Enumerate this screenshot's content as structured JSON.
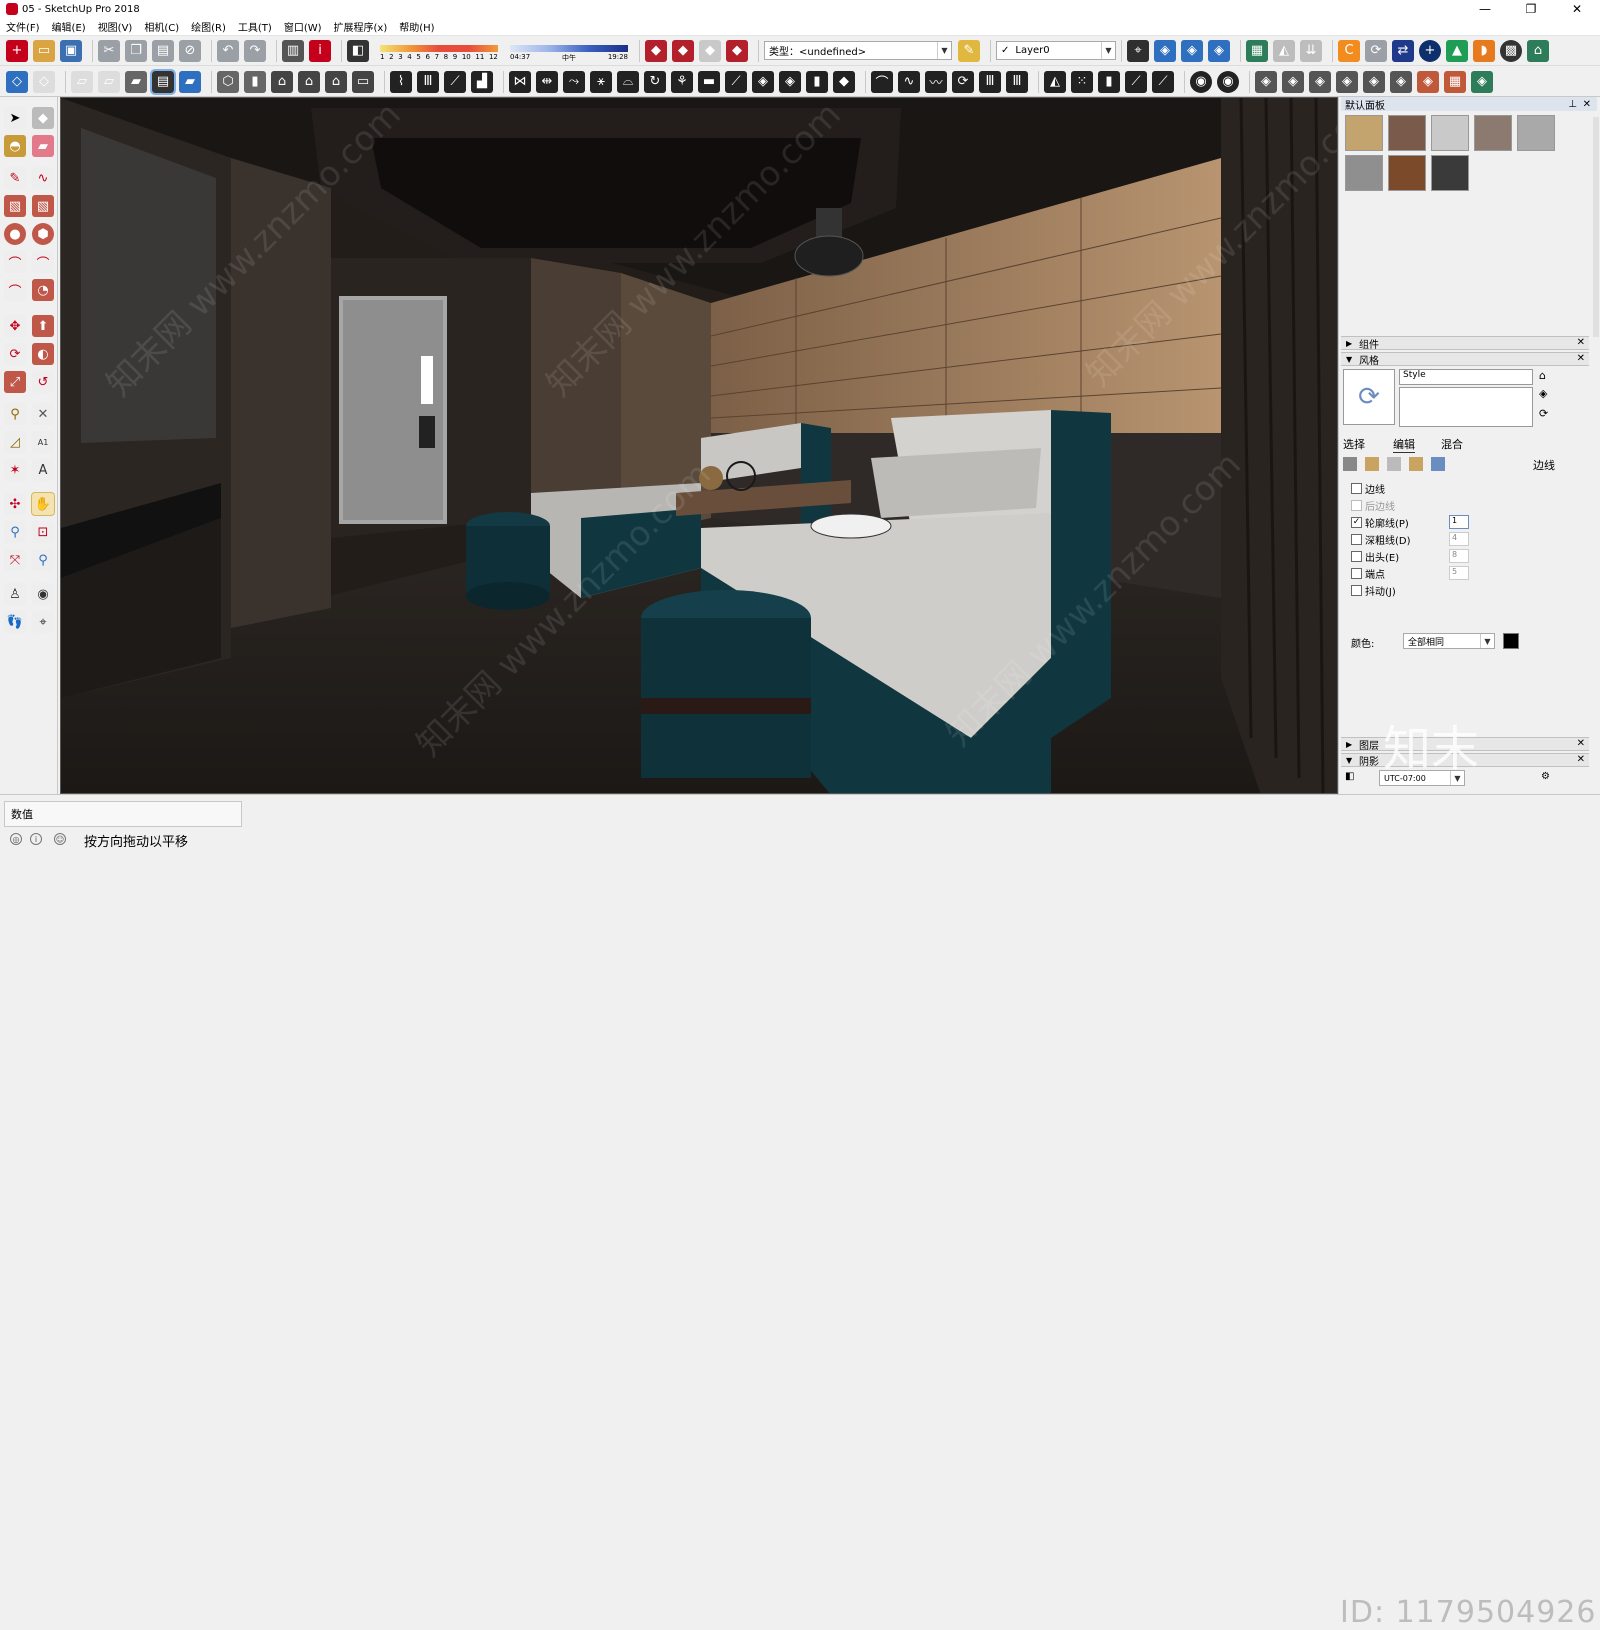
{
  "window": {
    "title": "05 - SketchUp Pro 2018",
    "controls": [
      "—",
      "❐",
      "✕"
    ]
  },
  "menu": [
    "文件(F)",
    "编辑(E)",
    "视图(V)",
    "相机(C)",
    "绘图(R)",
    "工具(T)",
    "窗口(W)",
    "扩展程序(x)",
    "帮助(H)"
  ],
  "toolbar": {
    "month_ticks": [
      "1",
      "2",
      "3",
      "4",
      "5",
      "6",
      "7",
      "8",
      "9",
      "10",
      "11",
      "12"
    ],
    "time_start": "04:37",
    "time_mid": "中午",
    "time_end": "19:28",
    "type_label": "类型：<undefined>",
    "layer_label": "Layer0",
    "layer_check": "✓"
  },
  "panel": {
    "title": "默认面板",
    "swatches": [
      "#c4a46e",
      "#7a5a4a",
      "#c9c9c9",
      "#8c7a70",
      "#a9a9a9",
      "#8f8f8f",
      "#7a4a2a",
      "#3a3a3a"
    ],
    "components_label": "组件",
    "styles_label": "风格",
    "style_name": "Style",
    "tabs": [
      "选择",
      "编辑",
      "混合"
    ],
    "edges_label": "边线",
    "options": [
      {
        "label": "边线",
        "checked": false,
        "value": ""
      },
      {
        "label": "后边线",
        "checked": false,
        "value": "",
        "disabled": true
      },
      {
        "label": "轮廓线(P)",
        "checked": true,
        "value": "1"
      },
      {
        "label": "深粗线(D)",
        "checked": false,
        "value": "4"
      },
      {
        "label": "出头(E)",
        "checked": false,
        "value": "8"
      },
      {
        "label": "端点",
        "checked": false,
        "value": "5"
      },
      {
        "label": "抖动(J)",
        "checked": false,
        "value": ""
      }
    ],
    "color_label": "颜色:",
    "color_value": "全部相同",
    "layers_label": "图层",
    "shadows_label": "阴影",
    "utc_value": "UTC-07:00"
  },
  "status": {
    "measure_label": "数值",
    "hint": "按方向拖动以平移"
  },
  "watermark": {
    "id_text": "ID: 1179504926",
    "logo_text": "知末",
    "site_text": "知末网 www.znzmo.com"
  },
  "colors": {
    "accent_red": "#c4001a",
    "blue": "#2f6fbf",
    "teal_sofa": "#10363f",
    "wood": "#9a7a58"
  }
}
